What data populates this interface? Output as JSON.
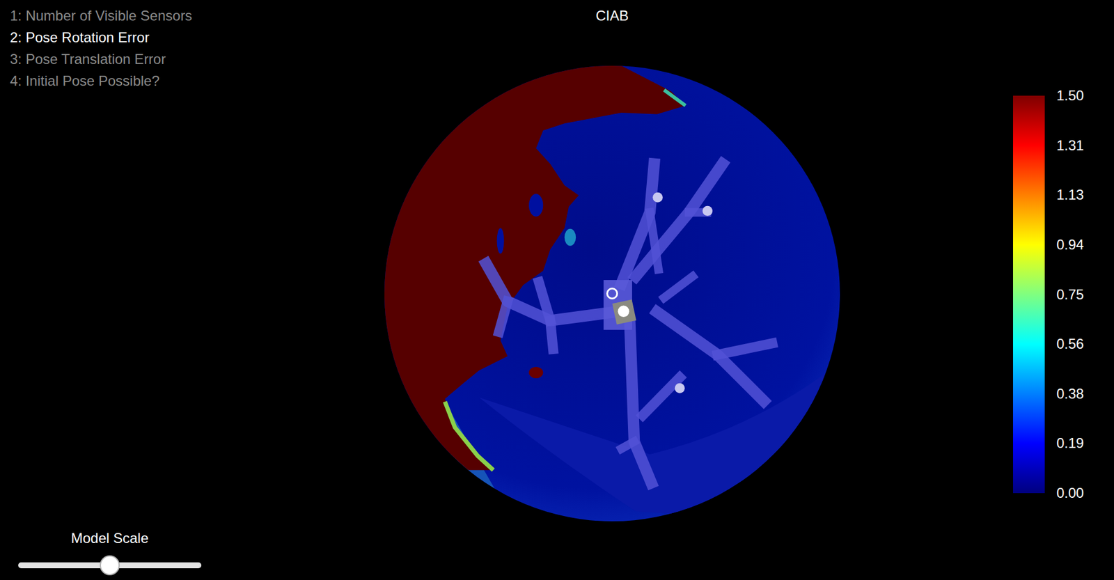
{
  "window": {
    "title": "CIAB"
  },
  "menu": [
    {
      "label": "1: Number of Visible Sensors",
      "selected": false
    },
    {
      "label": "2: Pose Rotation Error",
      "selected": true
    },
    {
      "label": "3: Pose Translation Error",
      "selected": false
    },
    {
      "label": "4: Initial Pose Possible?",
      "selected": false
    }
  ],
  "colorbar": {
    "labels": [
      "1.50",
      "1.31",
      "1.13",
      "0.94",
      "0.75",
      "0.56",
      "0.38",
      "0.19",
      "0.00"
    ]
  },
  "slider": {
    "label": "Model Scale",
    "level": 0.5
  }
}
